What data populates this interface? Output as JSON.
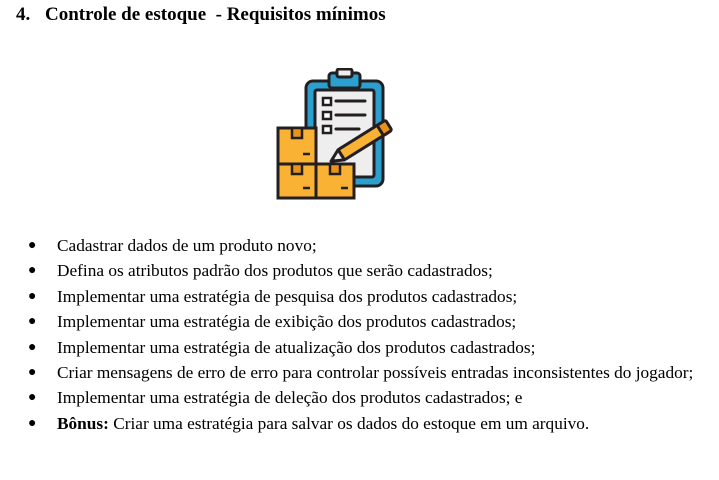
{
  "heading": {
    "number": "4.",
    "title": "Controle de estoque  - Requisitos mínimos"
  },
  "illustration": {
    "icon": "inventory-clipboard-boxes-icon",
    "colors": {
      "box_fill": "#F9B233",
      "box_dark": "#E8941C",
      "clipboard_frame": "#2A9FD0",
      "paper": "#EEEEEE",
      "pencil": "#F9B233",
      "outline": "#231F20"
    }
  },
  "requirements": {
    "bullet": "●",
    "items": [
      {
        "prefix": "",
        "text": "Cadastrar dados de um produto novo;"
      },
      {
        "prefix": "",
        "text": "Defina os atributos padrão dos produtos que serão cadastrados;"
      },
      {
        "prefix": "",
        "text": "Implementar uma estratégia de pesquisa dos produtos cadastrados;"
      },
      {
        "prefix": "",
        "text": "Implementar uma estratégia de exibição dos produtos cadastrados;"
      },
      {
        "prefix": "",
        "text": "Implementar uma estratégia de atualização dos produtos cadastrados;"
      },
      {
        "prefix": "",
        "text": "Criar mensagens de erro de erro para controlar possíveis entradas inconsistentes do jogador;"
      },
      {
        "prefix": "",
        "text": "Implementar uma estratégia de deleção dos produtos cadastrados; e"
      },
      {
        "prefix": "Bônus:",
        "text": " Criar uma estratégia para salvar os dados do estoque em um arquivo."
      }
    ]
  }
}
